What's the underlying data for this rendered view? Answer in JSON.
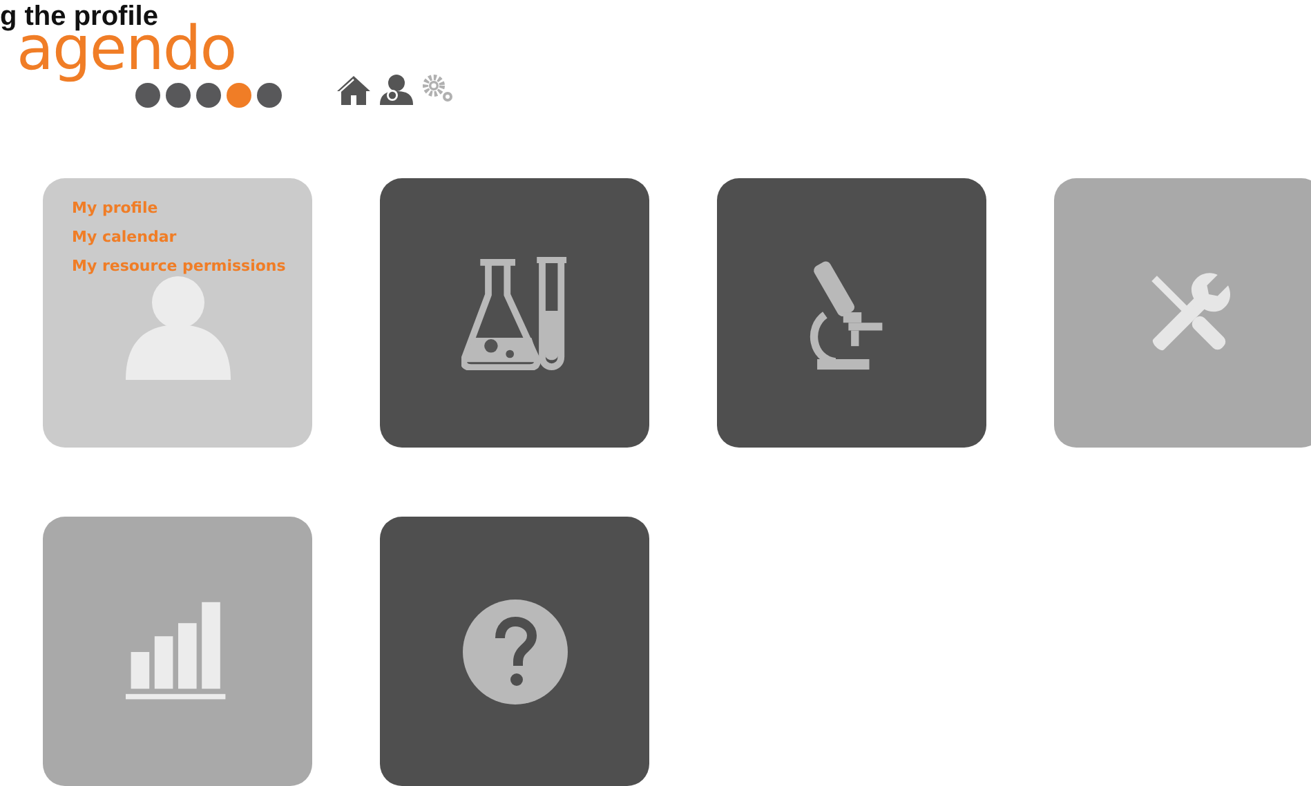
{
  "page_title": "g the profile",
  "logo": {
    "text": "agendo",
    "dots": [
      {
        "color": "#58585a"
      },
      {
        "color": "#58585a"
      },
      {
        "color": "#58585a"
      },
      {
        "color": "#f07d26"
      },
      {
        "color": "#58585a"
      }
    ]
  },
  "toolbar": [
    {
      "kind": "home",
      "disabled": false
    },
    {
      "kind": "user",
      "disabled": false
    },
    {
      "kind": "settings",
      "disabled": true
    }
  ],
  "tiles": [
    {
      "kind": "profile",
      "disabled": true,
      "links": [
        "My profile",
        "My calendar",
        "My resource permissions"
      ]
    },
    {
      "kind": "lab",
      "disabled": false
    },
    {
      "kind": "microscope",
      "disabled": false
    },
    {
      "kind": "tools",
      "disabled": true
    },
    {
      "kind": "chart",
      "disabled": true
    },
    {
      "kind": "help",
      "disabled": false
    }
  ]
}
